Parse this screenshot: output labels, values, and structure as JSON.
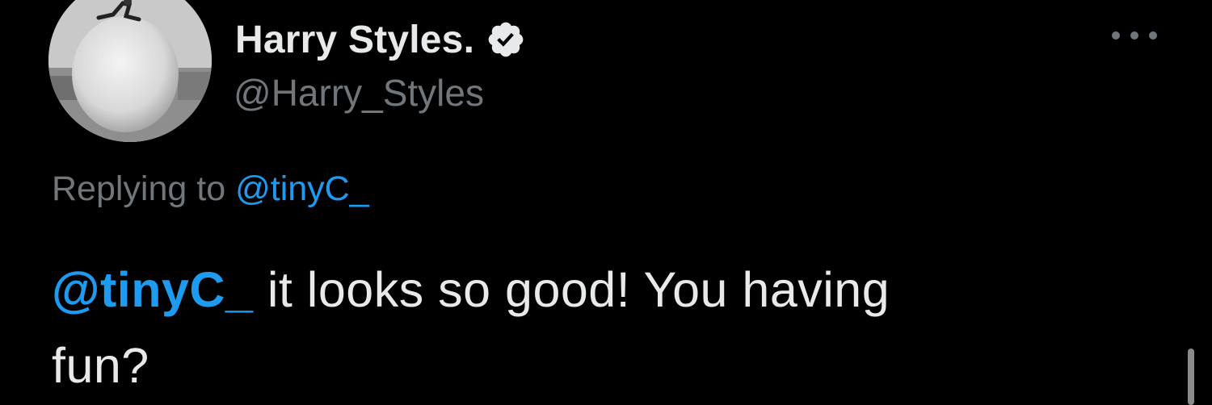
{
  "tweet": {
    "author": {
      "display_name": "Harry Styles.",
      "handle": "@Harry_Styles",
      "verified": true,
      "verified_icon": "verified-badge-icon",
      "avatar_icon": "profile-photo"
    },
    "more_icon": "more-options-icon",
    "reply": {
      "prefix": "Replying to",
      "mention": "@tinyC_"
    },
    "body": {
      "mention": "@tinyC_",
      "text_line1": " it looks so good! You having",
      "text_line2": "fun?"
    }
  },
  "colors": {
    "background": "#000000",
    "primary_text": "#e7e9ea",
    "secondary_text": "#71767b",
    "link": "#1d9bf0"
  }
}
